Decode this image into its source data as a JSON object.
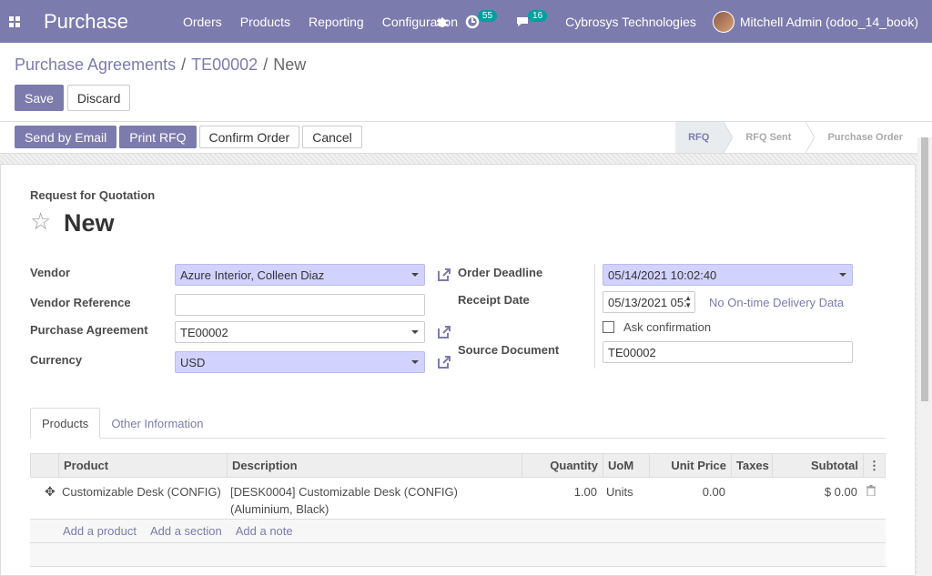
{
  "topnav": {
    "app_name": "Purchase",
    "menu": [
      "Orders",
      "Products",
      "Reporting",
      "Configuration"
    ],
    "activity_count": "55",
    "message_count": "16",
    "company": "Cybrosys Technologies",
    "user": "Mitchell Admin (odoo_14_book)"
  },
  "breadcrumb": {
    "parent": "Purchase Agreements",
    "record": "TE00002",
    "current": "New",
    "separator": "/"
  },
  "control": {
    "save": "Save",
    "discard": "Discard"
  },
  "statusbar": {
    "buttons": [
      "Send by Email",
      "Print RFQ",
      "Confirm Order",
      "Cancel"
    ],
    "stages": [
      "RFQ",
      "RFQ Sent",
      "Purchase Order"
    ],
    "current_stage": "RFQ"
  },
  "form": {
    "doc_type": "Request for Quotation",
    "name": "New",
    "vendor_label": "Vendor",
    "vendor_value": "Azure Interior, Colleen Diaz",
    "vendor_ref_label": "Vendor Reference",
    "vendor_ref_value": "",
    "agreement_label": "Purchase Agreement",
    "agreement_value": "TE00002",
    "currency_label": "Currency",
    "currency_value": "USD",
    "deadline_label": "Order Deadline",
    "deadline_value": "05/14/2021 10:02:40",
    "receipt_label": "Receipt Date",
    "receipt_value": "05/13/2021 05:",
    "no_delivery": "No On-time Delivery Data",
    "ask_confirmation": "Ask confirmation",
    "source_label": "Source Document",
    "source_value": "TE00002"
  },
  "tabs": [
    "Products",
    "Other Information"
  ],
  "table": {
    "headers": [
      "Product",
      "Description",
      "Quantity",
      "UoM",
      "Unit Price",
      "Taxes",
      "Subtotal"
    ],
    "rows": [
      {
        "product": "Customizable Desk (CONFIG)",
        "description_line1": "[DESK0004] Customizable Desk (CONFIG)",
        "description_line2": "(Aluminium, Black)",
        "quantity": "1.00",
        "uom": "Units",
        "unit_price": "0.00",
        "taxes": "",
        "subtotal": "$ 0.00"
      }
    ],
    "add_links": [
      "Add a product",
      "Add a section",
      "Add a note"
    ]
  },
  "colors": {
    "brand": "#7c7bad",
    "required_bg": "#d2d2ff",
    "badge": "#00a09d"
  }
}
